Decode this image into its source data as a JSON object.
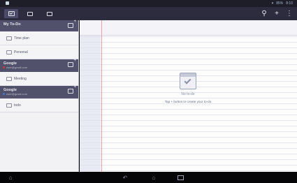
{
  "status_bar": {
    "time": "8:10",
    "battery": "85%"
  },
  "action_bar": {
    "app_icon": "checkbox-icon",
    "buttons": [
      "search-icon",
      "add-icon",
      "overflow-menu-icon"
    ]
  },
  "sidebar": {
    "accounts": [
      {
        "title": "My To-Do",
        "subtitle": "",
        "dot_color": "",
        "lists": [
          "Time plan",
          "Personal"
        ]
      },
      {
        "title": "Google",
        "subtitle": "user@gmail.com",
        "dot_color": "#d23a3a",
        "lists": [
          "Meeting"
        ]
      },
      {
        "title": "Google",
        "subtitle": "user@gmail.com",
        "dot_color": "#3a7ad2",
        "lists": [
          "todo"
        ]
      }
    ]
  },
  "main": {
    "empty_title": "No to-do",
    "empty_hint": "Tap + button to create your to-do"
  },
  "nav_bar": {
    "buttons": [
      "home-icon",
      "back-icon",
      "home-icon",
      "recent-apps-icon"
    ]
  }
}
